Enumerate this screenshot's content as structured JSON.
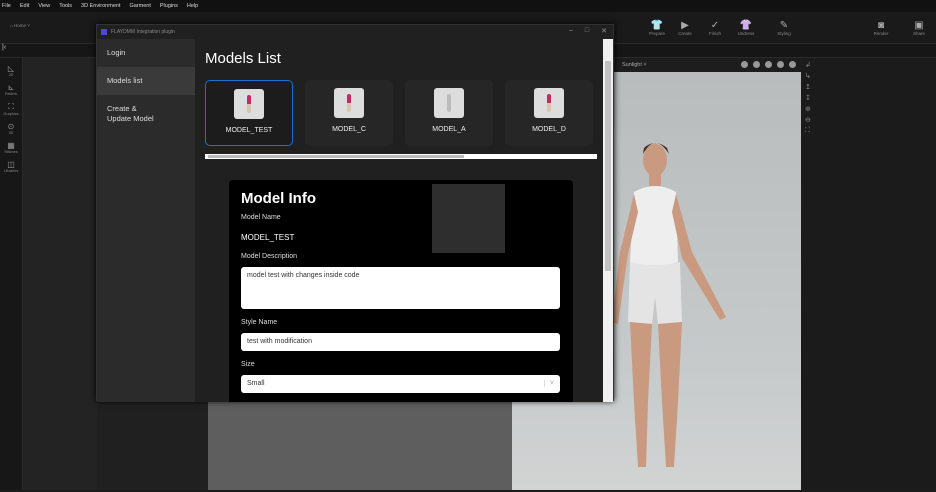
{
  "menu": [
    "File",
    "Edit",
    "View",
    "Tools",
    "3D Environment",
    "Garment",
    "Plugins",
    "Help"
  ],
  "toolbar": {
    "home": "Home",
    "items": [
      "Prepare",
      "Create",
      "Finish",
      "Undress",
      "Styling",
      "Render",
      "Share"
    ]
  },
  "side_icons": [
    "2D",
    "Pattern",
    "Graphics",
    "3D",
    "Stitches",
    "Libraries"
  ],
  "viewport": {
    "mode": "Sunlight"
  },
  "plugin": {
    "title": "FLAYDMM Integration plugin",
    "nav": [
      "Login",
      "Models list",
      "Create & Update Model"
    ],
    "heading": "Models List",
    "models": [
      {
        "name": "MODEL_TEST",
        "selected": true
      },
      {
        "name": "MODEL_C"
      },
      {
        "name": "MODEL_A"
      },
      {
        "name": "MODEL_D"
      }
    ],
    "info": {
      "title": "Model Info",
      "name_label": "Model Name",
      "name_value": "MODEL_TEST",
      "desc_label": "Model Description",
      "desc_value": "model test with changes inside code",
      "style_label": "Style Name",
      "style_value": "test with modification",
      "size_label": "Size",
      "size_value": "Small"
    }
  }
}
